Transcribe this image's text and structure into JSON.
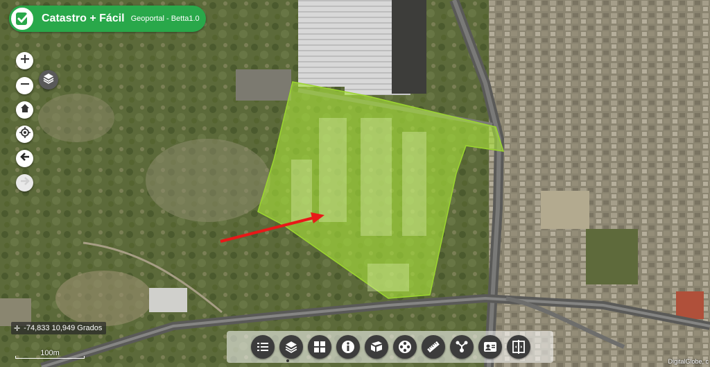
{
  "app": {
    "title": "Catastro + Fácil",
    "subtitle": "Geoportal - Betta1.0",
    "logo_icon": "check-shield-icon",
    "brand_color": "#29a84a"
  },
  "map_controls": [
    {
      "name": "zoom-in-button",
      "icon": "plus-icon"
    },
    {
      "name": "zoom-out-button",
      "icon": "minus-icon"
    },
    {
      "name": "home-button",
      "icon": "home-icon"
    },
    {
      "name": "locate-button",
      "icon": "locate-icon"
    },
    {
      "name": "back-button",
      "icon": "arrow-left-icon"
    },
    {
      "name": "forward-button",
      "icon": "arrow-right-icon",
      "disabled": true
    }
  ],
  "basemap_button": {
    "icon": "layers-icon"
  },
  "coordinates": {
    "text": "-74,833 10,949 Grados"
  },
  "scale": {
    "label": "100m"
  },
  "toolbar": {
    "tools": [
      {
        "name": "legend-tool",
        "icon": "list-icon"
      },
      {
        "name": "layers-tool",
        "icon": "layers-icon"
      },
      {
        "name": "basemaps-tool",
        "icon": "grid-icon"
      },
      {
        "name": "info-tool",
        "icon": "info-icon"
      },
      {
        "name": "print-tool",
        "icon": "print-icon"
      },
      {
        "name": "film-tool",
        "icon": "film-reel-icon"
      },
      {
        "name": "measure-tool",
        "icon": "ruler-icon"
      },
      {
        "name": "share-tool",
        "icon": "share-icon"
      },
      {
        "name": "profile-tool",
        "icon": "id-card-icon"
      },
      {
        "name": "swipe-tool",
        "icon": "swipe-icon"
      }
    ]
  },
  "map": {
    "highlight_color": "#a8e23a",
    "arrow_color": "#e81818"
  },
  "attribution": "DigitalGlobe, c"
}
